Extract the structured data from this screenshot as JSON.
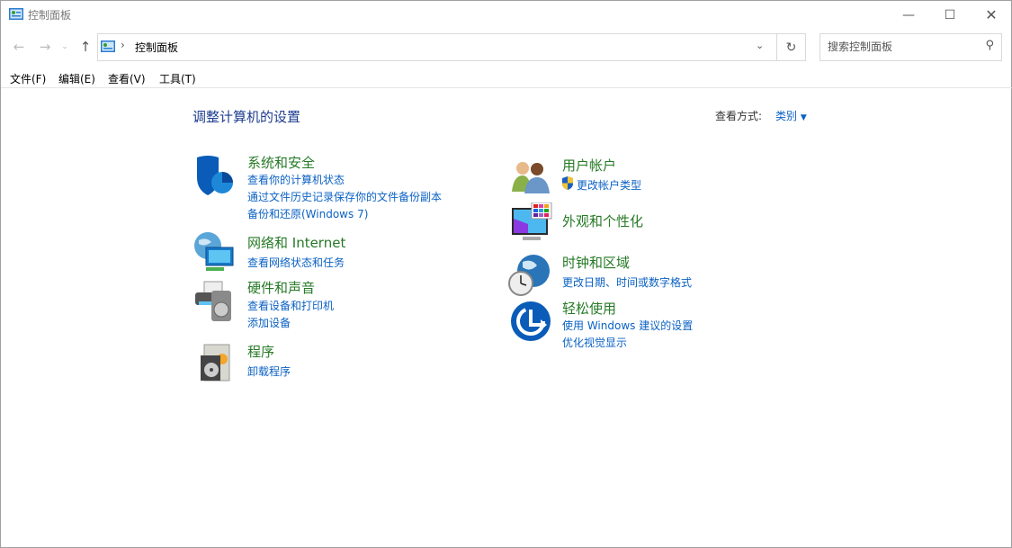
{
  "window": {
    "title": "控制面板",
    "icon": "control-panel-icon",
    "controls": [
      "minimize",
      "maximize",
      "close"
    ]
  },
  "nav": {
    "address": "控制面板",
    "search_placeholder": "搜索控制面板"
  },
  "menu": [
    "文件(F)",
    "编辑(E)",
    "查看(V)",
    "工具(T)"
  ],
  "main": {
    "heading": "调整计算机的设置",
    "view_label": "查看方式:",
    "view_value": "类别",
    "left": [
      {
        "title": "系统和安全",
        "icon": "shield-icon",
        "links": [
          "查看你的计算机状态",
          "通过文件历史记录保存你的文件备份副本",
          "备份和还原(Windows 7)"
        ]
      },
      {
        "title": "网络和 Internet",
        "icon": "network-globe-icon",
        "links": [
          "查看网络状态和任务"
        ]
      },
      {
        "title": "硬件和声音",
        "icon": "printer-speaker-icon",
        "links": [
          "查看设备和打印机",
          "添加设备"
        ]
      },
      {
        "title": "程序",
        "icon": "programs-disc-icon",
        "links": [
          "卸载程序"
        ]
      }
    ],
    "right": [
      {
        "title": "用户帐户",
        "icon": "users-icon",
        "links": [
          "更改帐户类型"
        ]
      },
      {
        "title": "外观和个性化",
        "icon": "monitor-palette-icon",
        "links": []
      },
      {
        "title": "时钟和区域",
        "icon": "globe-clock-icon",
        "links": [
          "更改日期、时间或数字格式"
        ]
      },
      {
        "title": "轻松使用",
        "icon": "ease-of-access-icon",
        "links": [
          "使用 Windows 建议的设置",
          "优化视觉显示"
        ]
      }
    ]
  }
}
